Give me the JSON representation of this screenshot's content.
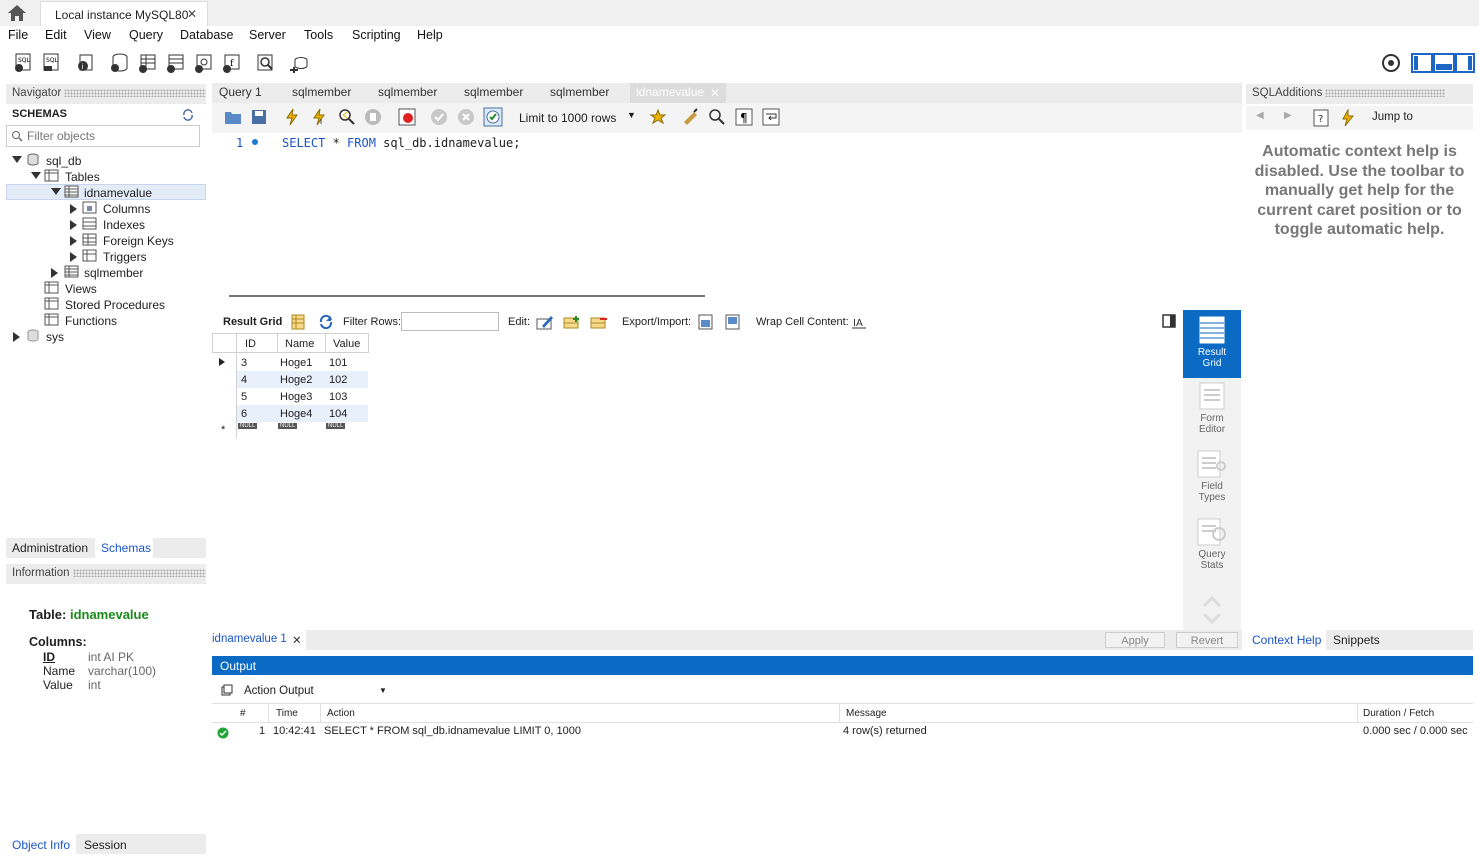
{
  "window": {
    "home_tab": "home",
    "connection_tab": "Local instance MySQL80"
  },
  "menu": [
    "File",
    "Edit",
    "View",
    "Query",
    "Database",
    "Server",
    "Tools",
    "Scripting",
    "Help"
  ],
  "navigator": {
    "title": "Navigator",
    "schemas_label": "SCHEMAS",
    "filter_placeholder": "Filter objects",
    "tree": {
      "db": "sql_db",
      "tables": "Tables",
      "table1": "idnamevalue",
      "columns": "Columns",
      "indexes": "Indexes",
      "foreign_keys": "Foreign Keys",
      "triggers": "Triggers",
      "table2": "sqlmember",
      "views": "Views",
      "procs": "Stored Procedures",
      "functions": "Functions",
      "sys": "sys"
    },
    "tabs": [
      "Administration",
      "Schemas"
    ],
    "info_title": "Information",
    "info": {
      "table_label": "Table:",
      "table_name": "idnamevalue",
      "columns_label": "Columns:",
      "cols": [
        {
          "name": "ID",
          "type": "int AI PK"
        },
        {
          "name": "Name",
          "type": "varchar(100)"
        },
        {
          "name": "Value",
          "type": "int"
        }
      ]
    },
    "bottom_tabs": [
      "Object Info",
      "Session"
    ]
  },
  "query_tabs": [
    "Query 1",
    "sqlmember",
    "sqlmember",
    "sqlmember",
    "sqlmember",
    "idnamevalue"
  ],
  "sql_toolbar": {
    "limit": "Limit to 1000 rows"
  },
  "editor": {
    "line_no": "1",
    "sql_kw1": "SELECT",
    "sql_rest1": " * ",
    "sql_kw2": "FROM",
    "sql_rest2": " sql_db.idnamevalue;"
  },
  "result_toolbar": {
    "result_grid": "Result Grid",
    "filter_rows": "Filter Rows:",
    "edit": "Edit:",
    "export": "Export/Import:",
    "wrap": "Wrap Cell Content:"
  },
  "grid": {
    "headers": [
      "ID",
      "Name",
      "Value"
    ],
    "rows": [
      [
        "3",
        "Hoge1",
        "101"
      ],
      [
        "4",
        "Hoge2",
        "102"
      ],
      [
        "5",
        "Hoge3",
        "103"
      ],
      [
        "6",
        "Hoge4",
        "104"
      ]
    ],
    "null": "NULL"
  },
  "side_buttons": [
    {
      "l1": "Result",
      "l2": "Grid"
    },
    {
      "l1": "Form",
      "l2": "Editor"
    },
    {
      "l1": "Field",
      "l2": "Types"
    },
    {
      "l1": "Query",
      "l2": "Stats"
    }
  ],
  "result_tab": "idnamevalue 1",
  "apply": "Apply",
  "revert": "Revert",
  "sql_additions": {
    "title": "SQLAdditions",
    "jump_to": "Jump to",
    "help_text": "Automatic context help is disabled. Use the toolbar to manually get help for the current caret position or to toggle automatic help.",
    "tabs": [
      "Context Help",
      "Snippets"
    ]
  },
  "output": {
    "title": "Output",
    "selector": "Action Output",
    "headers": [
      "#",
      "Time",
      "Action",
      "Message",
      "Duration / Fetch"
    ],
    "rows": [
      {
        "num": "1",
        "time": "10:42:41",
        "action": "SELECT * FROM sql_db.idnamevalue LIMIT 0, 1000",
        "message": "4 row(s) returned",
        "duration": "0.000 sec / 0.000 sec"
      }
    ]
  },
  "colors": {
    "accent": "#0a6ac4",
    "keyword": "#1a55c8",
    "success": "#22a336",
    "schema_green": "#1a8a1a"
  }
}
